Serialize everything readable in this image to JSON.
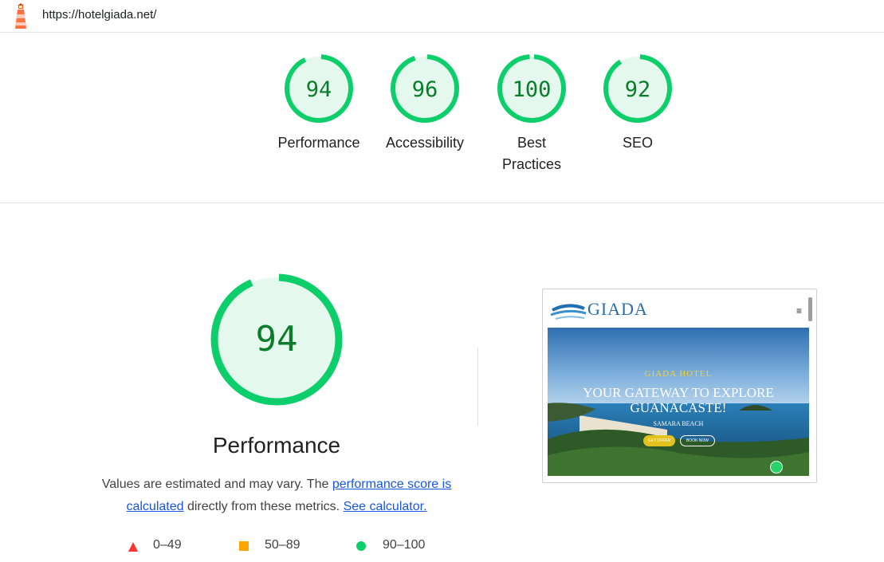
{
  "header": {
    "url": "https://hotelgiada.net/"
  },
  "colors": {
    "pass": "#0cce6b",
    "pass_bg": "#e5f8ed",
    "score_text": "#0a7d2c",
    "fail": "#ff3333",
    "average": "#ffa400",
    "link": "#1a56db"
  },
  "icons": {
    "logo": "lighthouse-icon",
    "menu": "hamburger-icon",
    "whatsapp": "whatsapp-icon"
  },
  "categories": [
    {
      "score": "94",
      "label": "Performance",
      "fraction": 0.94
    },
    {
      "score": "96",
      "label": "Accessibility",
      "fraction": 0.96
    },
    {
      "score": "100",
      "label": "Best Practices",
      "fraction": 1.0
    },
    {
      "score": "92",
      "label": "SEO",
      "fraction": 0.92
    }
  ],
  "performance": {
    "score": "94",
    "fraction": 0.94,
    "title": "Performance",
    "desc_before": "Values are estimated and may vary. The ",
    "desc_link1": "performance score is calculated",
    "desc_middle": " directly from these metrics. ",
    "desc_link2": "See calculator."
  },
  "legend": [
    {
      "range": "0–49",
      "shape": "triangle"
    },
    {
      "range": "50–89",
      "shape": "square"
    },
    {
      "range": "90–100",
      "shape": "circle"
    }
  ],
  "screenshot": {
    "brand": "GIADA",
    "menu_glyph": "≡",
    "hero_subtitle": "GIADA HOTEL",
    "hero_title": "YOUR GATEWAY TO EXPLORE GUANACASTE!",
    "hero_location": "SAMARA BEACH",
    "button_offer": "GET OFFER",
    "button_book": "BOOK NOW"
  }
}
